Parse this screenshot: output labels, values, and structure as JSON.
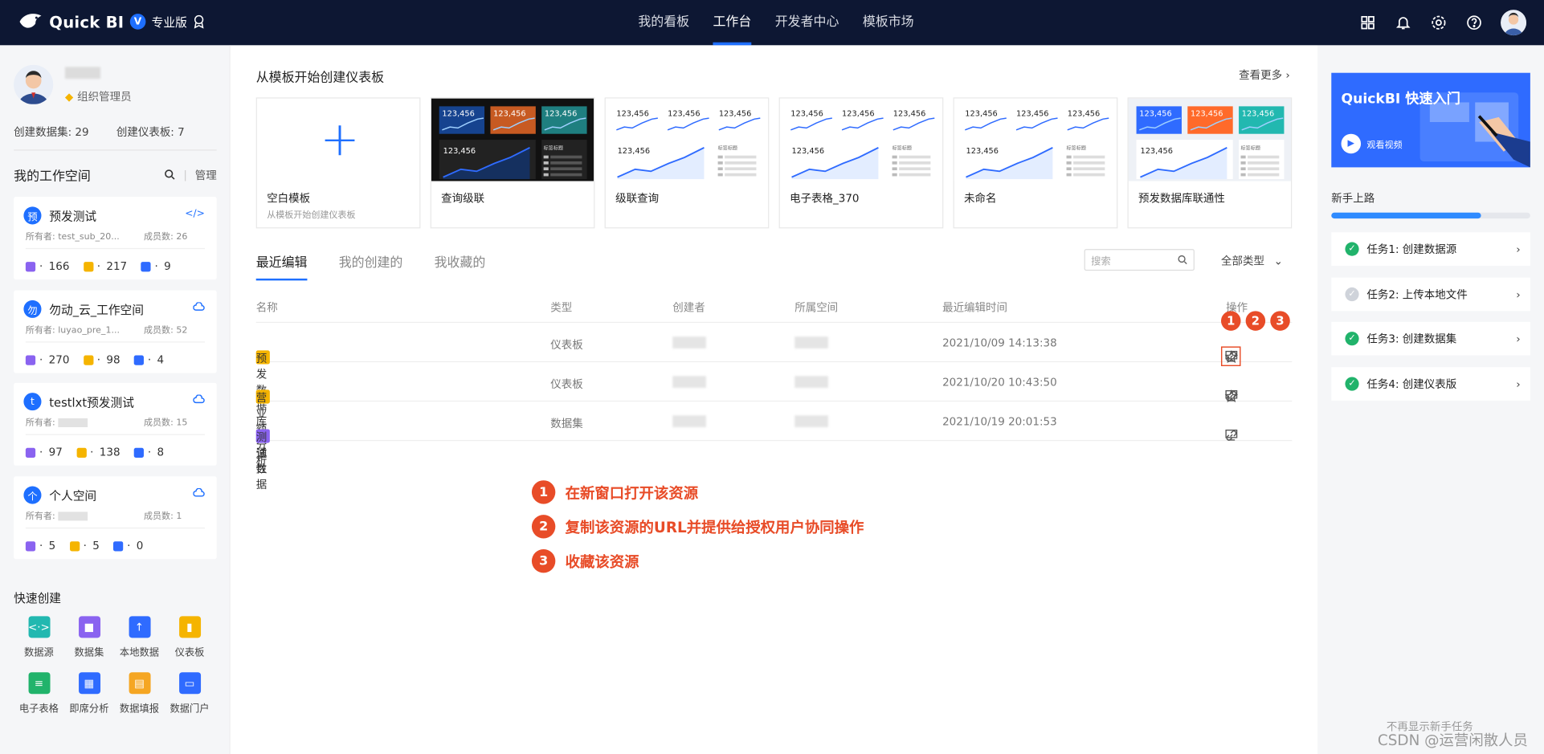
{
  "topbar": {
    "brand": "Quick BI",
    "badge": "V",
    "edition": "专业版",
    "nav": [
      "我的看板",
      "工作台",
      "开发者中心",
      "模板市场"
    ],
    "nav_active": 1
  },
  "profile": {
    "role": "组织管理员",
    "stat_datasets": "创建数据集: 29",
    "stat_dashboards": "创建仪表板: 7"
  },
  "workspace": {
    "title": "我的工作空间",
    "manage": "管理",
    "owner_label": "所有者:",
    "members_label": "成员数:",
    "items": [
      {
        "badge": "预",
        "name": "预发测试",
        "tag": "</>",
        "owner": "test_sub_20...",
        "members": "26",
        "c1": "166",
        "c2": "217",
        "c3": "9"
      },
      {
        "badge": "勿",
        "name": "勿动_云_工作空间",
        "tag": "cloud",
        "owner": "luyao_pre_1...",
        "members": "52",
        "c1": "270",
        "c2": "98",
        "c3": "4"
      },
      {
        "badge": "t",
        "name": "testlxt预发测试",
        "tag": "cloud",
        "owner": "",
        "members": "15",
        "c1": "97",
        "c2": "138",
        "c3": "8"
      },
      {
        "badge": "个",
        "name": "个人空间",
        "tag": "cloud",
        "owner": "",
        "members": "1",
        "c1": "5",
        "c2": "5",
        "c3": "0"
      }
    ]
  },
  "quick": {
    "title": "快速创建",
    "items": [
      {
        "label": "数据源",
        "color": "#22b8b0",
        "glyph": "<·>"
      },
      {
        "label": "数据集",
        "color": "#8a63f0",
        "glyph": "■"
      },
      {
        "label": "本地数据",
        "color": "#2f6bff",
        "glyph": "↑"
      },
      {
        "label": "仪表板",
        "color": "#f5b400",
        "glyph": "▮"
      },
      {
        "label": "电子表格",
        "color": "#21b36b",
        "glyph": "≡"
      },
      {
        "label": "即席分析",
        "color": "#2f6bff",
        "glyph": "▦"
      },
      {
        "label": "数据填报",
        "color": "#f5a623",
        "glyph": "▤"
      },
      {
        "label": "数据门户",
        "color": "#2f6bff",
        "glyph": "▭"
      }
    ]
  },
  "templates": {
    "title": "从模板开始创建仪表板",
    "more": "查看更多",
    "number": "123,456",
    "minor_label": "标签标题",
    "cards": [
      {
        "name": "空白模板",
        "sub": "从模板开始创建仪表板",
        "style": "blank"
      },
      {
        "name": "查询级联",
        "style": "dark"
      },
      {
        "name": "级联查询",
        "style": "light"
      },
      {
        "name": "电子表格_370",
        "style": "light"
      },
      {
        "name": "未命名",
        "style": "light"
      },
      {
        "name": "预发数据库联通性",
        "style": "color"
      }
    ]
  },
  "tabs": [
    "最近编辑",
    "我的创建的",
    "我收藏的"
  ],
  "tabs_active": 0,
  "search": {
    "placeholder": "搜索"
  },
  "filter": "全部类型",
  "table": {
    "headers": [
      "名称",
      "类型",
      "创建者",
      "所属空间",
      "最近编辑时间",
      "操作"
    ],
    "rows": [
      {
        "name": "预发数据库联通性",
        "type": "仪表板",
        "time": "2021/10/09 14:13:38",
        "icon": "dashboard",
        "star": true
      },
      {
        "name": "营业额分析",
        "type": "仪表板",
        "time": "2021/10/20 10:43:50",
        "icon": "dashboard",
        "star": true
      },
      {
        "name": "测试数据",
        "type": "数据集",
        "time": "2021/10/19 20:01:53",
        "icon": "dataset",
        "star": false
      }
    ]
  },
  "annotations": [
    {
      "n": "1",
      "text": "在新窗口打开该资源"
    },
    {
      "n": "2",
      "text": "复制该资源的URL并提供给授权用户协同操作"
    },
    {
      "n": "3",
      "text": "收藏该资源"
    }
  ],
  "right": {
    "banner_title": "QuickBI 快速入门",
    "banner_play": "观看视频",
    "newbie": "新手上路",
    "progress": 0.75,
    "tasks": [
      {
        "label": "任务1:  创建数据源",
        "done": true
      },
      {
        "label": "任务2:  上传本地文件",
        "done": false
      },
      {
        "label": "任务3:  创建数据集",
        "done": true
      },
      {
        "label": "任务4:  创建仪表版",
        "done": true
      }
    ],
    "hide_tip": "不再显示新手任务"
  },
  "watermark": "CSDN @运营闲散人员",
  "colors": {
    "accent": "#1e6fff",
    "annot": "#e84c28",
    "topbar": "#0d1733"
  }
}
